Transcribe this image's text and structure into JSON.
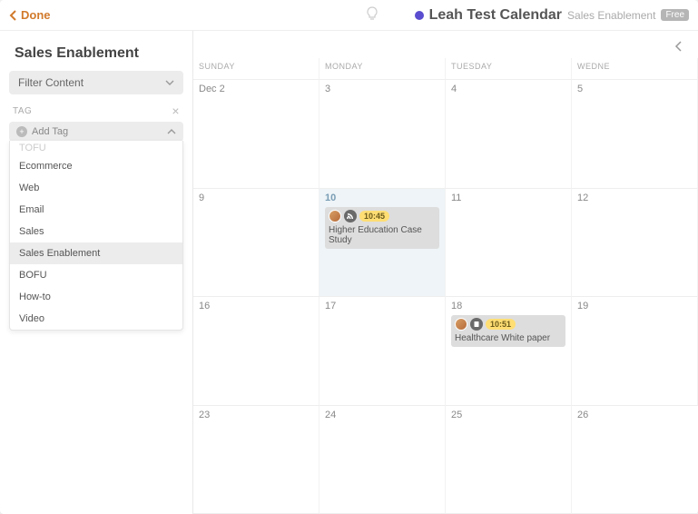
{
  "topbar": {
    "done": "Done",
    "calendar_name": "Leah Test Calendar",
    "calendar_sub": "Sales Enablement",
    "badge": "Free"
  },
  "sidebar": {
    "title": "Sales Enablement",
    "filter_label": "Filter Content",
    "tag_header": "TAG",
    "add_tag": "Add Tag",
    "tags": [
      "TOFU",
      "Ecommerce",
      "Web",
      "Email",
      "Sales",
      "Sales Enablement",
      "BOFU",
      "How-to",
      "Video"
    ],
    "selected_tag": "Sales Enablement"
  },
  "calendar": {
    "day_headers": [
      "SUNDAY",
      "MONDAY",
      "TUESDAY",
      "WEDNE"
    ],
    "rows": [
      [
        {
          "num": "Dec 2"
        },
        {
          "num": "3"
        },
        {
          "num": "4"
        },
        {
          "num": "5"
        }
      ],
      [
        {
          "num": "9"
        },
        {
          "num": "10",
          "highlight": true,
          "event": {
            "time": "10:45",
            "title": "Higher Education Case Study",
            "icon": "rss"
          }
        },
        {
          "num": "11"
        },
        {
          "num": "12"
        }
      ],
      [
        {
          "num": "16"
        },
        {
          "num": "17"
        },
        {
          "num": "18",
          "event": {
            "time": "10:51",
            "title": "Healthcare White paper",
            "icon": "doc"
          }
        },
        {
          "num": "19"
        }
      ],
      [
        {
          "num": "23"
        },
        {
          "num": "24"
        },
        {
          "num": "25"
        },
        {
          "num": "26"
        }
      ]
    ]
  }
}
